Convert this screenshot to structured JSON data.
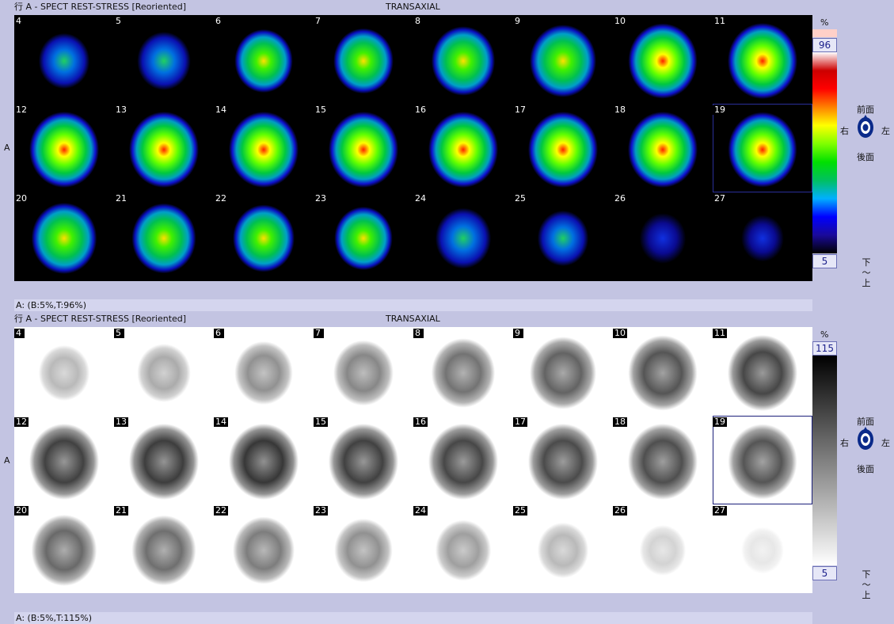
{
  "top_panel": {
    "header_left": "行 A - SPECT REST-STRESS [Reoriented]",
    "header_center": "TRANSAXIAL",
    "row_label": "A",
    "slices": [
      "4",
      "5",
      "6",
      "7",
      "8",
      "9",
      "10",
      "11",
      "12",
      "13",
      "14",
      "15",
      "16",
      "17",
      "18",
      "19",
      "20",
      "21",
      "22",
      "23",
      "24",
      "25",
      "26",
      "27"
    ],
    "selected_slice": "19",
    "scale": {
      "unit": "%",
      "max": "96",
      "min": "5"
    },
    "footer": "A: (B:5%,T:96%)"
  },
  "bottom_panel": {
    "header_left": "行 A - SPECT REST-STRESS [Reoriented]",
    "header_center": "TRANSAXIAL",
    "row_label": "A",
    "slices": [
      "4",
      "5",
      "6",
      "7",
      "8",
      "9",
      "10",
      "11",
      "12",
      "13",
      "14",
      "15",
      "16",
      "17",
      "18",
      "19",
      "20",
      "21",
      "22",
      "23",
      "24",
      "25",
      "26",
      "27"
    ],
    "selected_slice": "19",
    "scale": {
      "unit": "%",
      "max": "115",
      "min": "5"
    },
    "footer": "A: (B:5%,T:115%)"
  },
  "orientation": {
    "top": "前面",
    "bottom": "後面",
    "left": "右",
    "right": "左",
    "icon": "head-orientation-icon"
  },
  "axis": {
    "from": "下",
    "sep": "～",
    "to": "上"
  },
  "colormap_color": [
    "#000000",
    "#1a0a9a",
    "#0000ff",
    "#00b0ff",
    "#00c060",
    "#00e000",
    "#80ff00",
    "#ffff00",
    "#ff8000",
    "#ff0000",
    "#cc0000",
    "#ffffff"
  ],
  "colormap_gray": [
    "#ffffff",
    "#000000"
  ],
  "slice_intensity": [
    0.35,
    0.42,
    0.55,
    0.6,
    0.7,
    0.78,
    0.85,
    0.92,
    0.95,
    0.97,
    1.0,
    0.95,
    0.92,
    0.9,
    0.88,
    0.85,
    0.75,
    0.72,
    0.65,
    0.55,
    0.48,
    0.35,
    0.22,
    0.12
  ]
}
